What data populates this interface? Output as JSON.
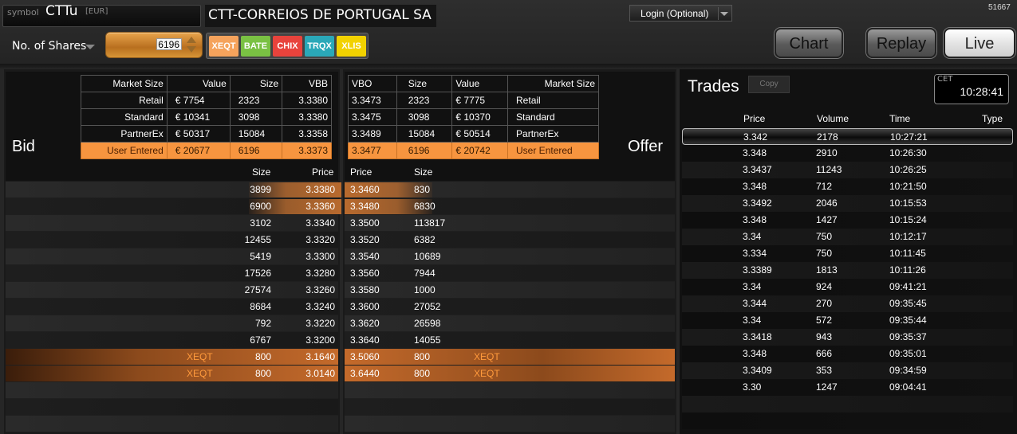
{
  "header": {
    "symbol_label": "symbol",
    "symbol": "CTTu",
    "currency": "[EUR]",
    "company": "CTT-CORREIOS DE PORTUGAL SA",
    "shares_label": "No. of Shares",
    "shares_value": "6196",
    "venues": [
      {
        "label": "XEQT",
        "color": "#f5a35c",
        "text": "#fff"
      },
      {
        "label": "BATE",
        "color": "#7ac143",
        "text": "#fff"
      },
      {
        "label": "CHIX",
        "color": "#e8433c",
        "text": "#fff"
      },
      {
        "label": "TRQX",
        "color": "#2aa8b8",
        "text": "#fff"
      },
      {
        "label": "XLIS",
        "color": "#f2d200",
        "text": "#fff"
      }
    ],
    "login": "Login (Optional)",
    "session_id": "51667",
    "buttons": {
      "chart": "Chart",
      "replay": "Replay",
      "live": "Live"
    }
  },
  "bid": {
    "label": "Bid",
    "summary_headers": [
      "Market Size",
      "Value",
      "Size",
      "VBB"
    ],
    "summary_rows": [
      [
        "Retail",
        "€ 7754",
        "2323",
        "3.3380"
      ],
      [
        "Standard",
        "€ 10341",
        "3098",
        "3.3380"
      ],
      [
        "PartnerEx",
        "€ 50317",
        "15084",
        "3.3358"
      ],
      [
        "User Entered",
        "€ 20677",
        "6196",
        "3.3373"
      ]
    ],
    "book_headers": {
      "size": "Size",
      "price": "Price"
    },
    "rows": [
      {
        "venue": "",
        "size": "3899",
        "price": "3.3380",
        "hl": true
      },
      {
        "venue": "",
        "size": "6900",
        "price": "3.3360",
        "hl": true
      },
      {
        "venue": "",
        "size": "3102",
        "price": "3.3340"
      },
      {
        "venue": "",
        "size": "12455",
        "price": "3.3320"
      },
      {
        "venue": "",
        "size": "5419",
        "price": "3.3300"
      },
      {
        "venue": "",
        "size": "17526",
        "price": "3.3280"
      },
      {
        "venue": "",
        "size": "27574",
        "price": "3.3260"
      },
      {
        "venue": "",
        "size": "8684",
        "price": "3.3240"
      },
      {
        "venue": "",
        "size": "792",
        "price": "3.3220"
      },
      {
        "venue": "",
        "size": "6767",
        "price": "3.3200"
      },
      {
        "venue": "XEQT",
        "size": "800",
        "price": "3.1640"
      },
      {
        "venue": "XEQT",
        "size": "800",
        "price": "3.0140"
      }
    ]
  },
  "offer": {
    "label": "Offer",
    "summary_headers": [
      "VBO",
      "Size",
      "Value",
      "Market Size"
    ],
    "summary_rows": [
      [
        "3.3473",
        "2323",
        "€ 7775",
        "Retail"
      ],
      [
        "3.3475",
        "3098",
        "€ 10370",
        "Standard"
      ],
      [
        "3.3489",
        "15084",
        "€ 50514",
        "PartnerEx"
      ],
      [
        "3.3477",
        "6196",
        "€ 20742",
        "User Entered"
      ]
    ],
    "book_headers": {
      "price": "Price",
      "size": "Size"
    },
    "rows": [
      {
        "price": "3.3460",
        "size": "830",
        "venue": "",
        "hl": true
      },
      {
        "price": "3.3480",
        "size": "6830",
        "venue": "",
        "hl": true
      },
      {
        "price": "3.3500",
        "size": "113817",
        "venue": ""
      },
      {
        "price": "3.3520",
        "size": "6382",
        "venue": ""
      },
      {
        "price": "3.3540",
        "size": "10689",
        "venue": ""
      },
      {
        "price": "3.3560",
        "size": "7944",
        "venue": ""
      },
      {
        "price": "3.3580",
        "size": "1000",
        "venue": ""
      },
      {
        "price": "3.3600",
        "size": "27052",
        "venue": ""
      },
      {
        "price": "3.3620",
        "size": "26598",
        "venue": ""
      },
      {
        "price": "3.3640",
        "size": "14055",
        "venue": ""
      },
      {
        "price": "3.5060",
        "size": "800",
        "venue": "XEQT"
      },
      {
        "price": "3.6440",
        "size": "800",
        "venue": "XEQT"
      }
    ]
  },
  "trades": {
    "title": "Trades",
    "copy": "Copy",
    "tz": "CET",
    "clock": "10:28:41",
    "headers": [
      "Price",
      "Volume",
      "Time",
      "Type"
    ],
    "rows": [
      [
        "3.342",
        "2178",
        "10:27:21",
        ""
      ],
      [
        "3.348",
        "2910",
        "10:26:30",
        ""
      ],
      [
        "3.3437",
        "11243",
        "10:26:25",
        ""
      ],
      [
        "3.348",
        "712",
        "10:21:50",
        ""
      ],
      [
        "3.3492",
        "2046",
        "10:15:53",
        ""
      ],
      [
        "3.348",
        "1427",
        "10:15:24",
        ""
      ],
      [
        "3.34",
        "750",
        "10:12:17",
        ""
      ],
      [
        "3.334",
        "750",
        "10:11:45",
        ""
      ],
      [
        "3.3389",
        "1813",
        "10:11:26",
        ""
      ],
      [
        "3.34",
        "924",
        "09:41:21",
        ""
      ],
      [
        "3.344",
        "270",
        "09:35:45",
        ""
      ],
      [
        "3.34",
        "572",
        "09:35:44",
        ""
      ],
      [
        "3.3418",
        "943",
        "09:35:37",
        ""
      ],
      [
        "3.348",
        "666",
        "09:35:01",
        ""
      ],
      [
        "3.3409",
        "353",
        "09:34:59",
        ""
      ],
      [
        "3.30",
        "1247",
        "09:04:41",
        ""
      ]
    ]
  }
}
